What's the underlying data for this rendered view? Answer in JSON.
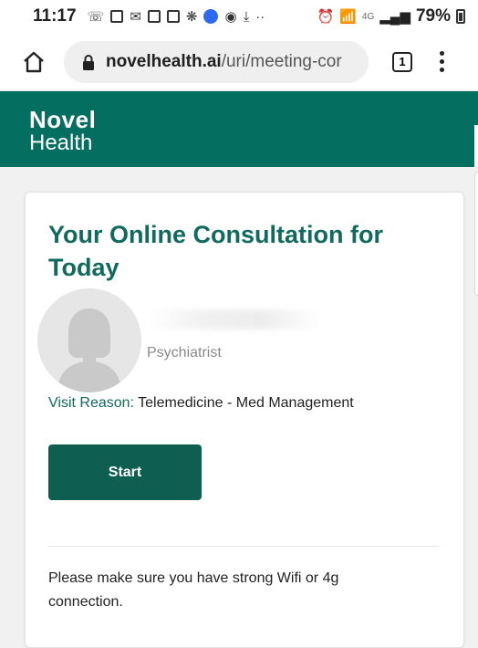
{
  "status_bar": {
    "time": "11:17",
    "network": "4G",
    "battery": "79%"
  },
  "browser": {
    "url_domain": "novelhealth.ai",
    "url_path": "/uri/meeting-cor",
    "tab_count": "1"
  },
  "app": {
    "logo_line1": "Novel",
    "logo_line2": "Health",
    "brand_color": "#046e61"
  },
  "consultation": {
    "title": "Your Online Consultation for Today",
    "specialty": "Psychiatrist",
    "visit_reason_label": "Visit Reason:",
    "visit_reason_value": "Telemedicine - Med Management",
    "start_label": "Start",
    "notice": "Please make sure you have strong Wifi or 4g connection."
  }
}
